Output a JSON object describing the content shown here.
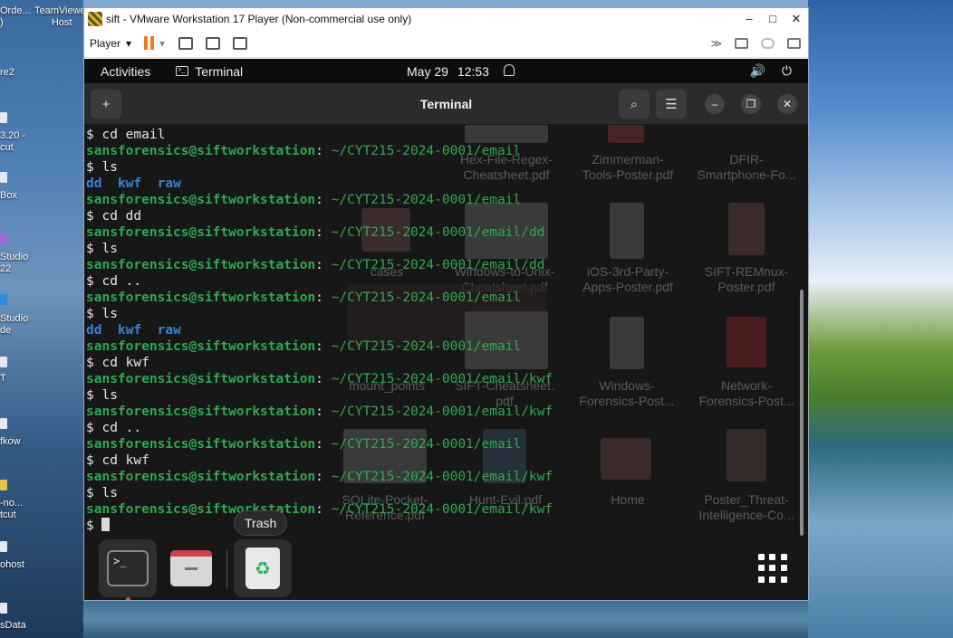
{
  "host": {
    "icons": [
      {
        "label": "Orde...",
        "label2": ")"
      },
      {
        "label": "TeamViewer",
        "label2": "Host"
      },
      {
        "label": "re2"
      },
      {
        "label": "3.20 -",
        "label2": "cut"
      },
      {
        "label": "Box"
      },
      {
        "label": "Studio",
        "label2": "22"
      },
      {
        "label": "Studio",
        "label2": "de"
      },
      {
        "label": "T"
      },
      {
        "label": "fkow"
      },
      {
        "label": "-no...",
        "label2": "tcut"
      },
      {
        "label": "ohost"
      },
      {
        "label": "sData"
      }
    ]
  },
  "vmware": {
    "title": "sift - VMware Workstation 17 Player (Non-commercial use only)",
    "minimize": "–",
    "maximize": "□",
    "close": "✕",
    "player_label": "Player",
    "player_arrow": "▾",
    "pause_arrow": "▾",
    "fast_forward": "≫"
  },
  "ubuntu": {
    "activities": "Activities",
    "app_name": "Terminal",
    "date": "May 29",
    "time": "12:53",
    "volume_icon": "🔊",
    "power_icon": "⏻"
  },
  "terminal": {
    "title": "Terminal",
    "new_tab_icon": "+",
    "search_icon": "⌕",
    "menu_icon": "☰",
    "minimize": "–",
    "restore": "❐",
    "close": "✕",
    "lines": [
      {
        "type": "cmd",
        "text": "$ cd email"
      },
      {
        "type": "prompt",
        "user": "sansforensics@siftworkstation",
        "path": "~/CYT215-2024-0001/email"
      },
      {
        "type": "cmd",
        "text": "$ ls"
      },
      {
        "type": "dirs",
        "items": [
          "dd",
          "kwf",
          "raw"
        ]
      },
      {
        "type": "prompt",
        "user": "sansforensics@siftworkstation",
        "path": "~/CYT215-2024-0001/email"
      },
      {
        "type": "cmd",
        "text": "$ cd dd"
      },
      {
        "type": "prompt",
        "user": "sansforensics@siftworkstation",
        "path": "~/CYT215-2024-0001/email/dd"
      },
      {
        "type": "cmd",
        "text": "$ ls"
      },
      {
        "type": "prompt",
        "user": "sansforensics@siftworkstation",
        "path": "~/CYT215-2024-0001/email/dd"
      },
      {
        "type": "cmd",
        "text": "$ cd .."
      },
      {
        "type": "prompt",
        "user": "sansforensics@siftworkstation",
        "path": "~/CYT215-2024-0001/email"
      },
      {
        "type": "cmd",
        "text": "$ ls"
      },
      {
        "type": "dirs",
        "items": [
          "dd",
          "kwf",
          "raw"
        ]
      },
      {
        "type": "prompt",
        "user": "sansforensics@siftworkstation",
        "path": "~/CYT215-2024-0001/email"
      },
      {
        "type": "cmd",
        "text": "$ cd kwf"
      },
      {
        "type": "prompt",
        "user": "sansforensics@siftworkstation",
        "path": "~/CYT215-2024-0001/email/kwf"
      },
      {
        "type": "cmd",
        "text": "$ ls"
      },
      {
        "type": "prompt",
        "user": "sansforensics@siftworkstation",
        "path": "~/CYT215-2024-0001/email/kwf"
      },
      {
        "type": "cmd",
        "text": "$ cd .."
      },
      {
        "type": "prompt",
        "user": "sansforensics@siftworkstation",
        "path": "~/CYT215-2024-0001/email"
      },
      {
        "type": "cmd",
        "text": "$ cd kwf"
      },
      {
        "type": "prompt",
        "user": "sansforensics@siftworkstation",
        "path": "~/CYT215-2024-0001/email/kwf"
      },
      {
        "type": "cmd",
        "text": "$ ls"
      },
      {
        "type": "prompt",
        "user": "sansforensics@siftworkstation",
        "path": "~/CYT215-2024-0001/email/kwf"
      },
      {
        "type": "cursor",
        "text": "$ "
      }
    ]
  },
  "desktop_ghosts": [
    {
      "label": "Hex-File-Regex-\nCheatsheet.pdf"
    },
    {
      "label": "Zimmerman-\nTools-Poster.pdf"
    },
    {
      "label": "DFIR-\nSmartphone-Fo..."
    },
    {
      "label": "cases"
    },
    {
      "label": "Windows-to-Unix-\nCheatsheet.pdf"
    },
    {
      "label": "iOS-3rd-Party-\nApps-Poster.pdf"
    },
    {
      "label": "SIFT-REMnux-\nPoster.pdf"
    },
    {
      "label": "mount_points"
    },
    {
      "label": "SIFT-Cheatsheet.\npdf"
    },
    {
      "label": "Windows-\nForensics-Post..."
    },
    {
      "label": "Network-\nForensics-Post..."
    },
    {
      "label": "SQLite-Pocket-\nReference.pdf"
    },
    {
      "label": "Hunt-Evil.pdf"
    },
    {
      "label": "Home"
    },
    {
      "label": "Poster_Threat-\nIntelligence-Co..."
    }
  ],
  "dock": {
    "tooltip": "Trash",
    "terminal_glyph": ">_",
    "trash_glyph": "♻"
  }
}
